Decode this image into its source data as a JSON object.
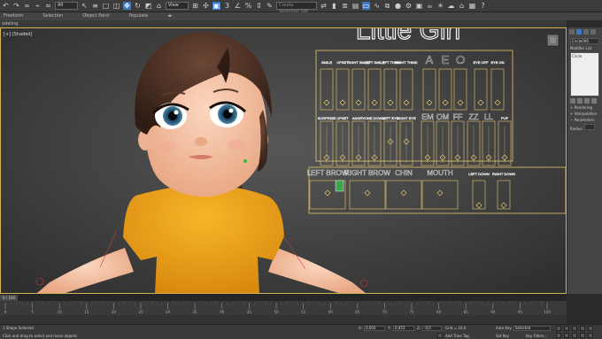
{
  "toolbar": {
    "selection_filter": "All",
    "view_mode": "View",
    "named_selection_placeholder": "Create Selection Set"
  },
  "ribbon": {
    "tabs": [
      "Freeform",
      "Selection",
      "Object Paint",
      "Populate"
    ],
    "sub_label": "odeling"
  },
  "viewport": {
    "label": "[+] [Shaded]",
    "board_title": "Little Girl",
    "top_row": [
      "SMILE",
      "UPSET",
      "RIGHT SMILE",
      "LEFT SMILE",
      "LEFT THINK",
      "RIGHT THINK",
      "A",
      "E",
      "O",
      "EYE OFF",
      "EYE ON"
    ],
    "mid_row": [
      "SURPRISE",
      "UPSET",
      "ANGRY",
      "ONE DOWN",
      "LEFT EYE",
      "RIGHT EYE",
      "EM",
      "OM",
      "FF",
      "ZZ",
      "LL",
      "PUF"
    ],
    "bottom_row": [
      "LEFT BROW",
      "RIGHT BROW",
      "CHIN",
      "MOUTH",
      "LEFT DOWN",
      "RIGHT DOWN"
    ]
  },
  "command_panel": {
    "object_name": "Circle006",
    "modifier_list": "Modifier List",
    "stack_item": "Circle",
    "rollouts": [
      "Rendering",
      "Interpolation",
      "Parameters"
    ],
    "radius_label": "Radius:"
  },
  "timeline": {
    "frame_label": "0 / 100",
    "ticks": [
      "0",
      "5",
      "10",
      "15",
      "20",
      "25",
      "30",
      "35",
      "40",
      "45",
      "50",
      "55",
      "60",
      "65",
      "70",
      "75",
      "80",
      "85",
      "90",
      "95",
      "100"
    ]
  },
  "status": {
    "selection": "1 Shape Selected",
    "prompt": "Click and drag to select and move objects",
    "x_label": "X:",
    "x_value": "0,003",
    "y_label": "Y:",
    "y_value": "0,453",
    "z_label": "Z:",
    "z_value": "-0,0",
    "grid": "Grid = 10,0",
    "add_time_tag": "Add Time Tag",
    "auto_key": "Auto Key",
    "selected": "Selected",
    "set_key": "Set Key",
    "key_filters": "Key Filters..."
  },
  "colors": {
    "shirt": "#f2a61e",
    "board_lines": "#e6c66e",
    "viewport_border": "#d3b45a",
    "hair": "#4a3126",
    "skin": "#f6c4a6"
  }
}
